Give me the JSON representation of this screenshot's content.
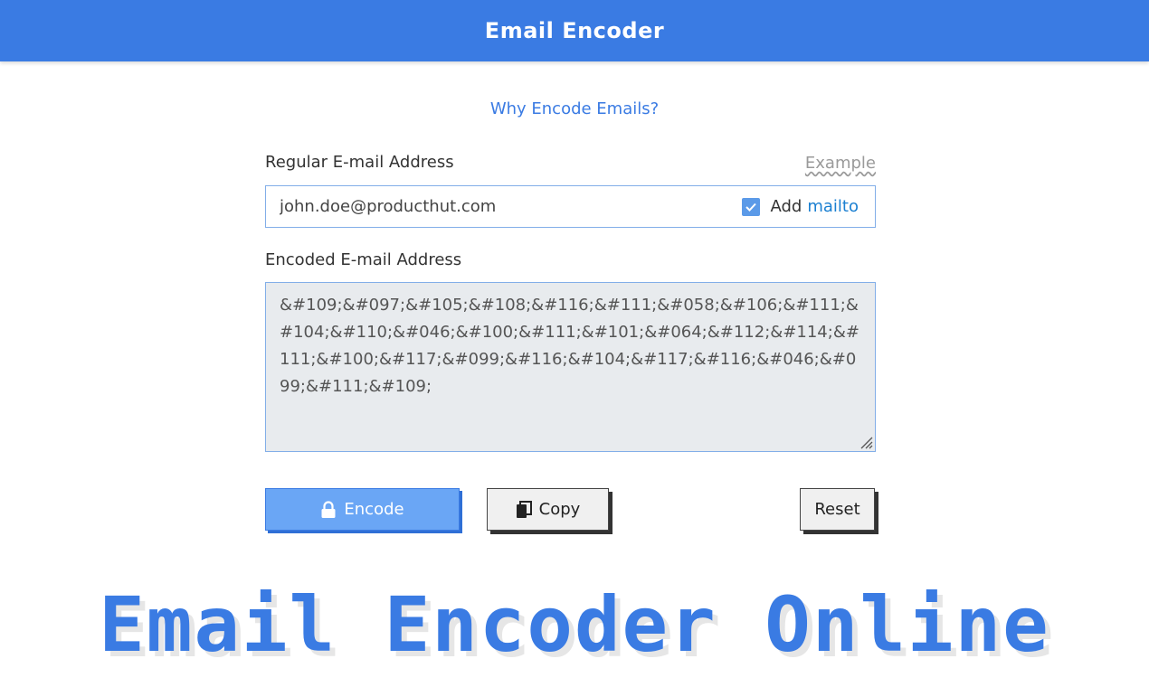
{
  "header": {
    "title": "Email Encoder"
  },
  "why_link": "Why Encode Emails?",
  "regular": {
    "label": "Regular E-mail Address",
    "example_link": "Example",
    "email_value": "john.doe@producthut.com",
    "add_label": "Add",
    "mailto_label": "mailto",
    "mailto_checked": true
  },
  "encoded": {
    "label": "Encoded E-mail Address",
    "value": "&#109;&#097;&#105;&#108;&#116;&#111;&#058;&#106;&#111;&#104;&#110;&#046;&#100;&#111;&#101;&#064;&#112;&#114;&#111;&#100;&#117;&#099;&#116;&#104;&#117;&#116;&#046;&#099;&#111;&#109;"
  },
  "buttons": {
    "encode": "Encode",
    "copy": "Copy",
    "reset": "Reset"
  },
  "banner": "Email Encoder Online",
  "colors": {
    "accent": "#3a7be3",
    "encode_button": "#6aa6f5",
    "textarea_bg": "#e8ebee"
  },
  "icons": {
    "encode": "lock-icon",
    "copy": "copy-icon",
    "checkbox": "check-icon"
  }
}
